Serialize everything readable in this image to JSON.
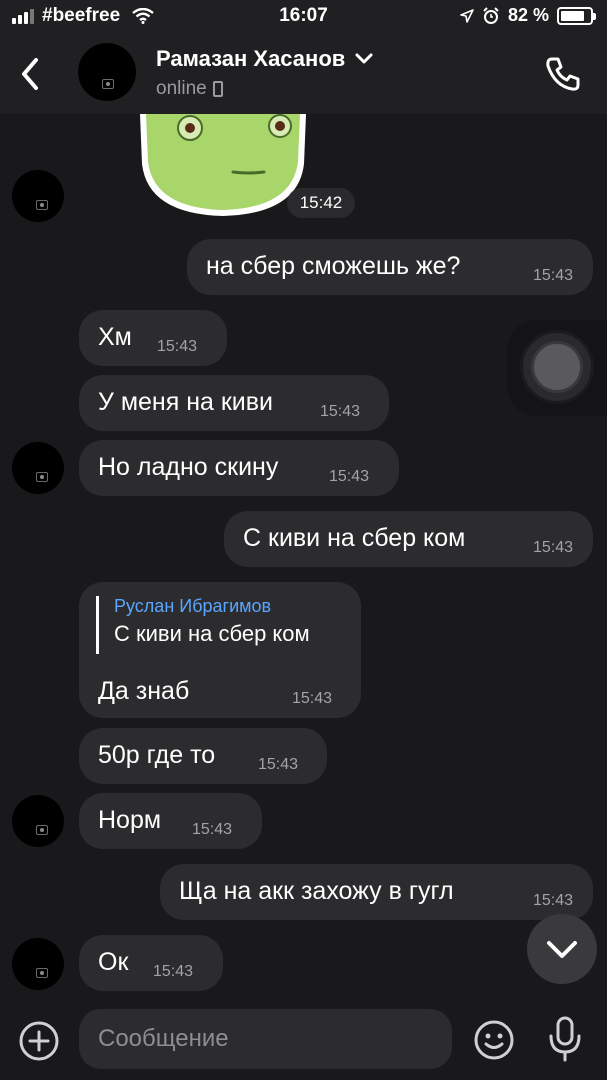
{
  "status_bar": {
    "carrier": "#beefree",
    "time": "16:07",
    "battery": "82 %",
    "battery_level": 0.82
  },
  "header": {
    "contact_name": "Рамазан Хасанов",
    "status": "online"
  },
  "chat": {
    "sticker_time": "15:42",
    "messages": [
      {
        "text": "на сбер сможешь же?",
        "time": "15:43",
        "direction": "out"
      },
      {
        "text": "Хм",
        "time": "15:43",
        "direction": "in"
      },
      {
        "text": "У меня на киви",
        "time": "15:43",
        "direction": "in"
      },
      {
        "text": "Но ладно скину",
        "time": "15:43",
        "direction": "in"
      },
      {
        "text": "С киви на сбер ком",
        "time": "15:43",
        "direction": "out"
      },
      {
        "text": "Да знаб",
        "time": "15:43",
        "direction": "in",
        "reply": {
          "author": "Руслан Ибрагимов",
          "text": "С киви на сбер ком"
        }
      },
      {
        "text": "50р где то",
        "time": "15:43",
        "direction": "in"
      },
      {
        "text": "Норм",
        "time": "15:43",
        "direction": "in"
      },
      {
        "text": "Ща на акк захожу в гугл",
        "time": "15:43",
        "direction": "out"
      },
      {
        "text": "Ок",
        "time": "15:43",
        "direction": "in"
      }
    ]
  },
  "composer": {
    "placeholder": "Сообщение"
  },
  "icons": {
    "back": "chevron-left-icon",
    "call": "phone-icon",
    "status": "device-icon",
    "expand": "chevron-down-icon",
    "scroll": "chevron-down-icon",
    "add": "plus-circle-icon",
    "emoji": "smile-icon",
    "mic": "microphone-icon",
    "record": "record-button"
  },
  "colors": {
    "background": "#19191b",
    "bubble": "#2c2c2e",
    "reply_author": "#5aa6ff",
    "time_text": "#a3a3a8"
  }
}
